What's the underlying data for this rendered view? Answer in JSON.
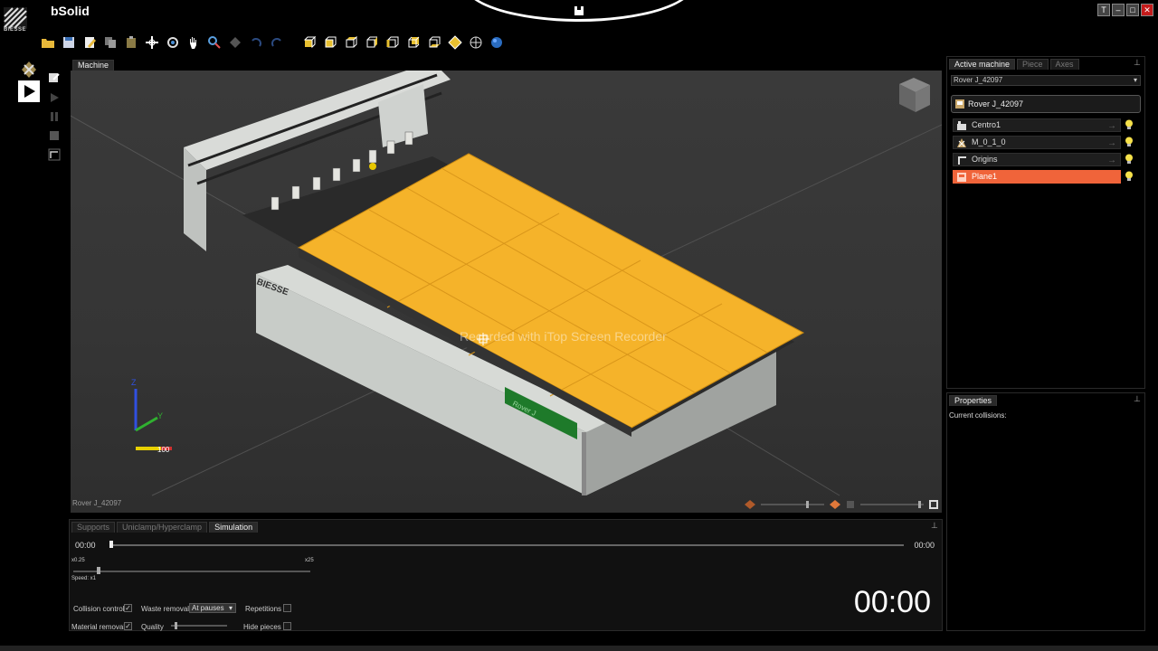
{
  "app": {
    "title": "bSolid",
    "logo_text": "BIESSE"
  },
  "window_buttons": [
    "T",
    "–",
    "□",
    "✕"
  ],
  "toolbar": {
    "icons": [
      "open-folder-icon",
      "save-icon",
      "edit-icon",
      "copy-icon",
      "paste-icon",
      "crosshair-icon",
      "rotate-icon",
      "pan-hand-icon",
      "zoom-icon",
      "zoom-window-icon",
      "undo-view-icon",
      "redo-view-icon",
      "cube-iso-icon",
      "cube-front-icon",
      "cube-top-icon",
      "cube-right-icon",
      "cube-left-icon",
      "cube-back-icon",
      "cube-bottom-icon",
      "globe-icon"
    ]
  },
  "machine_panel": {
    "tab": "Machine",
    "footer": "Rover J_42097",
    "watermark": "Recorded with iTop Screen Recorder",
    "brand_on_machine": "BIESSE",
    "green_plate_text": "Rover J",
    "axis_labels": {
      "x": "X",
      "y": "Y",
      "z": "Z",
      "scale": "100"
    }
  },
  "sim_panel": {
    "tabs": [
      "Supports",
      "Uniclamp/Hyperclamp",
      "Simulation"
    ],
    "active_tab": "Simulation",
    "time_start": "00:00",
    "time_end": "00:00",
    "speed_min": "x0.25",
    "speed_max": "x25",
    "speed_label": "Speed: x1",
    "options": {
      "collision_control": "Collision control",
      "waste_removal": "Waste removal",
      "waste_removal_value": "At pauses",
      "repetitions": "Repetitions",
      "material_removal": "Material removal",
      "quality": "Quality",
      "hide_pieces": "Hide pieces"
    },
    "big_time": "00:00"
  },
  "active_panel": {
    "tabs": [
      "Active machine",
      "Piece",
      "Axes"
    ],
    "active_tab": "Active machine",
    "machine_select": "Rover J_42097",
    "machine_header": "Rover J_42097",
    "items": [
      {
        "label": "Centro1",
        "icon": "centro-icon",
        "selected": false
      },
      {
        "label": "M_0_1_0",
        "icon": "machine-group-icon",
        "selected": false
      },
      {
        "label": "Origins",
        "icon": "origin-icon",
        "selected": false
      },
      {
        "label": "Plane1",
        "icon": "plane-icon",
        "selected": true
      }
    ]
  },
  "props_panel": {
    "tab": "Properties",
    "content": "Current collisions:"
  },
  "colors": {
    "accent": "#f0643a",
    "table": "#f5b32a",
    "bulb": "#f6e14a"
  }
}
